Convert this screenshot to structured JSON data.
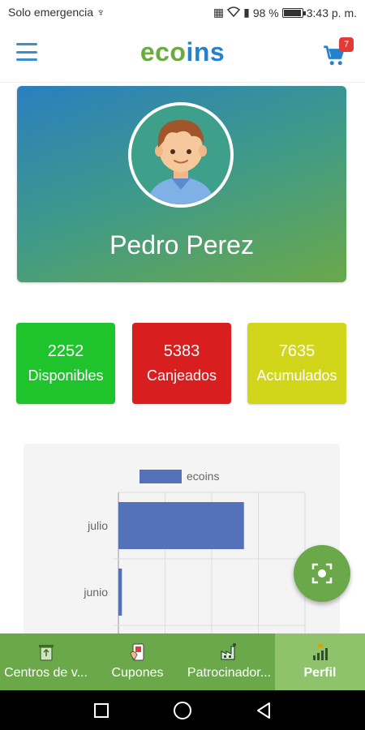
{
  "status_bar": {
    "carrier": "Solo emergencia",
    "battery": "98 %",
    "battery_level": 0.98,
    "time": "3:43 p. m."
  },
  "app_bar": {
    "logo_part1": "eco",
    "logo_part2": "ins",
    "cart_badge": "7"
  },
  "profile": {
    "name": "Pedro Perez"
  },
  "stats": [
    {
      "value": "2252",
      "label": "Disponibles",
      "color": "#1fc32b"
    },
    {
      "value": "5383",
      "label": "Canjeados",
      "color": "#d81e1e"
    },
    {
      "value": "7635",
      "label": "Acumulados",
      "color": "#d2d61b"
    }
  ],
  "chart_data": {
    "type": "bar",
    "orientation": "horizontal",
    "categories": [
      "julio",
      "junio"
    ],
    "series": [
      {
        "name": "ecoins",
        "values": [
          5383,
          150
        ],
        "color": "#5472b9"
      }
    ],
    "xlim": [
      0,
      8000
    ],
    "grid": true,
    "legend": "top"
  },
  "tabs": [
    {
      "label": "Centros de v...",
      "icon": "recycle-bin-icon",
      "active": false
    },
    {
      "label": "Cupones",
      "icon": "coupon-icon",
      "active": false
    },
    {
      "label": "Patrocinador...",
      "icon": "factory-icon",
      "active": false
    },
    {
      "label": "Perfil",
      "icon": "profile-chart-icon",
      "active": true
    }
  ],
  "colors": {
    "accent_green": "#6aa84a",
    "accent_blue": "#2481cc"
  }
}
